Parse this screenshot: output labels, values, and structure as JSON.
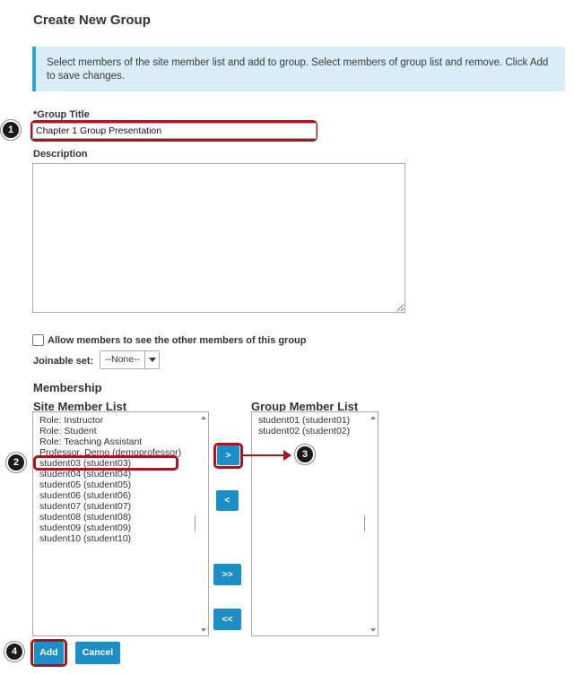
{
  "page": {
    "title": "Create New Group"
  },
  "info": {
    "message": "Select members of the site member list and add to group. Select members of group list and remove. Click Add to save changes."
  },
  "form": {
    "group_title_label": "*Group Title",
    "group_title_value": "Chapter 1 Group Presentation",
    "description_label": "Description",
    "description_value": "",
    "allow_label": "Allow members to see the other members of this group",
    "joinable_label": "Joinable set:",
    "joinable_value": "--None--"
  },
  "membership": {
    "heading": "Membership",
    "site_list_label": "Site Member List",
    "group_list_label": "Group Member List",
    "site_members": [
      "Role: Instructor",
      "Role: Student",
      "Role: Teaching Assistant",
      "Professor, Demo (demoprofessor)",
      "student03 (student03)",
      "student04 (student04)",
      "student05 (student05)",
      "student06 (student06)",
      "student07 (student07)",
      "student08 (student08)",
      "student09 (student09)",
      "student10 (student10)"
    ],
    "group_members": [
      "student01 (student01)",
      "student02 (student02)"
    ],
    "buttons": {
      "add_one": ">",
      "remove_one": "<",
      "add_all": ">>",
      "remove_all": "<<"
    }
  },
  "actions": {
    "add_label": "Add",
    "cancel_label": "Cancel"
  },
  "callouts": [
    "1",
    "2",
    "3",
    "4"
  ],
  "colors": {
    "accent": "#1e8fc6",
    "annotation": "#a5161f",
    "info_bg": "#d9edf7"
  }
}
